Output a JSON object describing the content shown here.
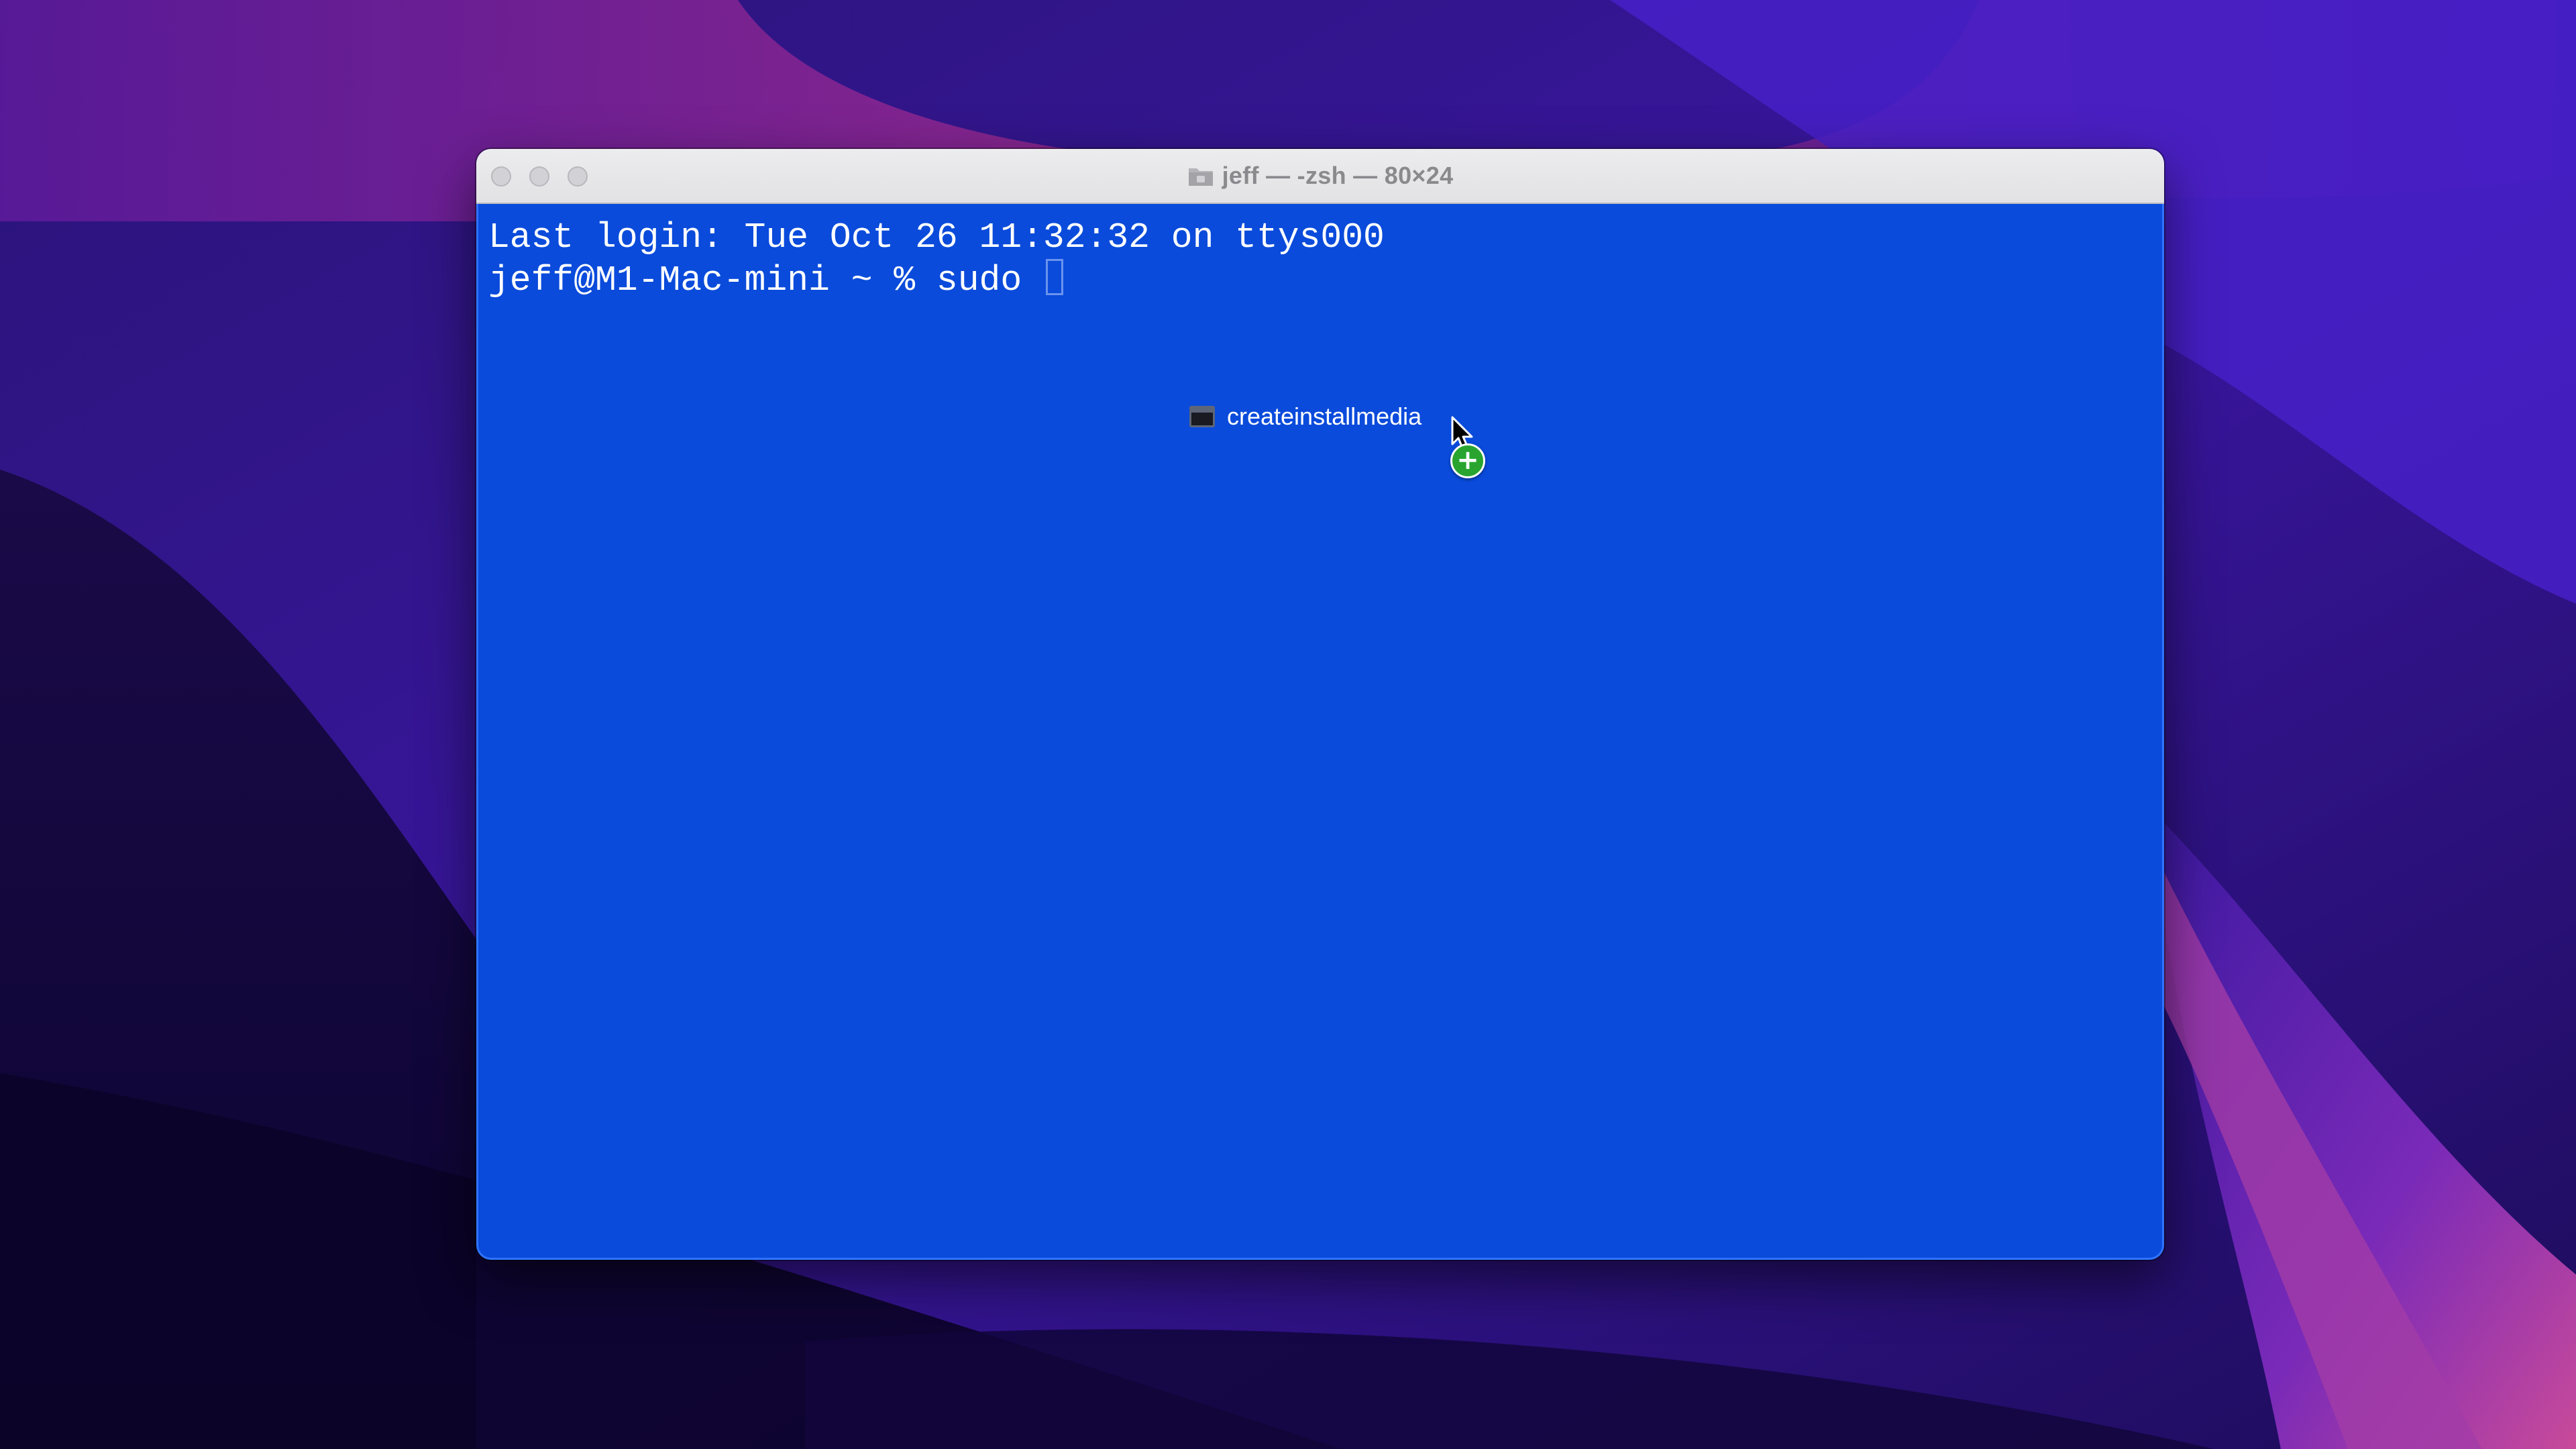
{
  "window": {
    "title": "jeff — -zsh — 80×24",
    "controls": [
      "close-button",
      "minimize-button",
      "zoom-button"
    ]
  },
  "terminal": {
    "lines": [
      "Last login: Tue Oct 26 11:32:32 on ttys000",
      "jeff@M1-Mac-mini ~ % sudo "
    ],
    "background": "#0a4bdb",
    "text_color": "#ffffff"
  },
  "drag": {
    "file_name": "createinstallmedia",
    "badge": "+",
    "icon": "terminal-executable-icon",
    "badge_icon": "copy-plus-icon"
  },
  "colors": {
    "desktop_dark": "#160a4a",
    "desktop_purple": "#5a1ea8",
    "desktop_magenta": "#c2308c",
    "badge_green": "#29a52f"
  }
}
